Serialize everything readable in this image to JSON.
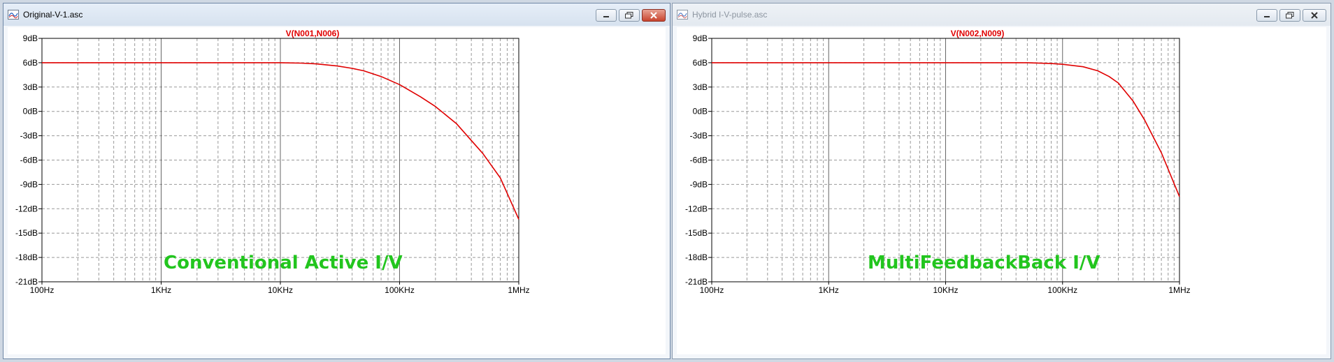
{
  "windows": [
    {
      "title": "Original-V-1.asc",
      "active": true,
      "plot": {
        "trace_label": "V(N001,N006)",
        "annotation": "Conventional Active I/V"
      }
    },
    {
      "title": "Hybrid I-V-pulse.asc",
      "active": false,
      "plot": {
        "trace_label": "V(N002,N009)",
        "annotation": "MultiFeedbackBack I/V"
      }
    }
  ],
  "colors": {
    "trace": "#e00000",
    "annotation": "#22c51e",
    "grid": "#555555"
  },
  "chart_data": [
    {
      "type": "line",
      "title": "V(N001,N006)",
      "xscale": "log",
      "xlim": [
        100,
        1000000
      ],
      "ylim": [
        -21,
        9
      ],
      "x_ticks": [
        "100Hz",
        "1KHz",
        "10KHz",
        "100KHz",
        "1MHz"
      ],
      "y_ticks": [
        "9dB",
        "6dB",
        "3dB",
        "0dB",
        "-3dB",
        "-6dB",
        "-9dB",
        "-12dB",
        "-15dB",
        "-18dB",
        "-21dB"
      ],
      "grid": true,
      "series": [
        {
          "name": "V(N001,N006)",
          "x": [
            100,
            1000,
            10000,
            15000,
            20000,
            30000,
            40000,
            50000,
            70000,
            100000,
            150000,
            200000,
            300000,
            500000,
            700000,
            1000000
          ],
          "y": [
            6,
            6,
            6,
            5.95,
            5.85,
            5.6,
            5.3,
            5.0,
            4.3,
            3.3,
            1.8,
            0.6,
            -1.5,
            -5.2,
            -8.2,
            -13.3
          ]
        }
      ]
    },
    {
      "type": "line",
      "title": "V(N002,N009)",
      "xscale": "log",
      "xlim": [
        100,
        1000000
      ],
      "ylim": [
        -21,
        9
      ],
      "x_ticks": [
        "100Hz",
        "1KHz",
        "10KHz",
        "100KHz",
        "1MHz"
      ],
      "y_ticks": [
        "9dB",
        "6dB",
        "3dB",
        "0dB",
        "-3dB",
        "-6dB",
        "-9dB",
        "-12dB",
        "-15dB",
        "-18dB",
        "-21dB"
      ],
      "grid": true,
      "series": [
        {
          "name": "V(N002,N009)",
          "x": [
            100,
            1000,
            10000,
            50000,
            80000,
            100000,
            150000,
            200000,
            250000,
            300000,
            400000,
            500000,
            700000,
            1000000
          ],
          "y": [
            6,
            6,
            6,
            6,
            5.9,
            5.8,
            5.5,
            5.0,
            4.3,
            3.5,
            1.3,
            -1.0,
            -5.1,
            -10.5
          ]
        }
      ]
    }
  ]
}
